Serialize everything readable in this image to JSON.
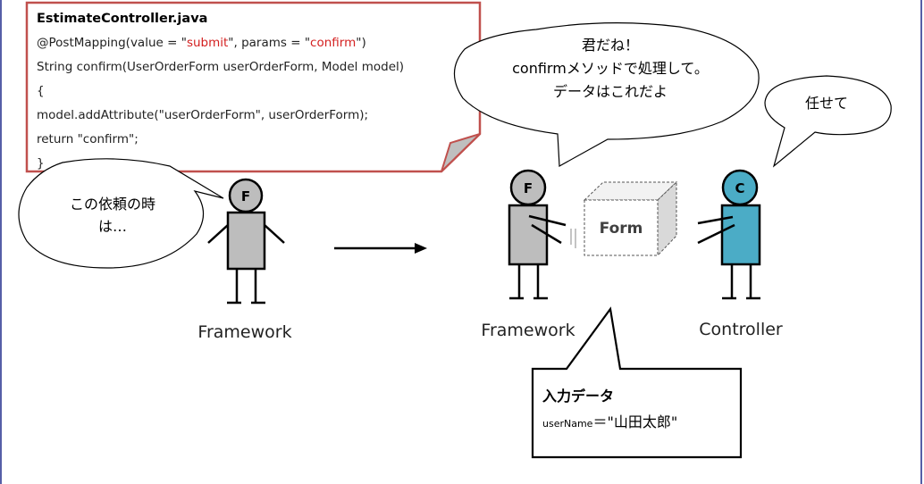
{
  "code_note": {
    "title": "EstimateController.java",
    "lines": [
      {
        "parts": [
          {
            "t": "@PostMapping(value = \""
          },
          {
            "t": "submit",
            "red": true
          },
          {
            "t": "\", params = \""
          },
          {
            "t": "confirm",
            "red": true
          },
          {
            "t": "\")"
          }
        ]
      },
      {
        "parts": [
          {
            "t": "String confirm(UserOrderForm userOrderForm, Model model)"
          }
        ]
      },
      {
        "parts": [
          {
            "t": "{"
          }
        ]
      },
      {
        "parts": [
          {
            "t": "    model.addAttribute(\"userOrderForm\", userOrderForm);"
          }
        ]
      },
      {
        "parts": [
          {
            "t": "    return \"confirm\";"
          }
        ]
      },
      {
        "parts": [
          {
            "t": "}"
          }
        ]
      }
    ]
  },
  "bubbles": {
    "left_question": [
      "この依頼の時",
      "は…"
    ],
    "framework_to_controller": [
      "君だね！",
      "confirmメソッドで処理して。",
      "データはこれだよ"
    ],
    "controller_reply": "任せて"
  },
  "actors": {
    "framework_left": {
      "head_letter": "F",
      "label": "Framework"
    },
    "framework_right": {
      "head_letter": "F",
      "label": "Framework"
    },
    "controller": {
      "head_letter": "C",
      "label": "Controller"
    }
  },
  "form_box_label": "Form",
  "input_data": {
    "title": "入力データ",
    "field_name": "userName",
    "equals": "＝",
    "value": "\"山田太郎\""
  },
  "colors": {
    "figure_gray": "#bdbdbd",
    "controller_teal": "#4bacc6",
    "note_border": "#c0504d",
    "highlight_red": "#d42020",
    "page_border": "#1f2a8a"
  }
}
